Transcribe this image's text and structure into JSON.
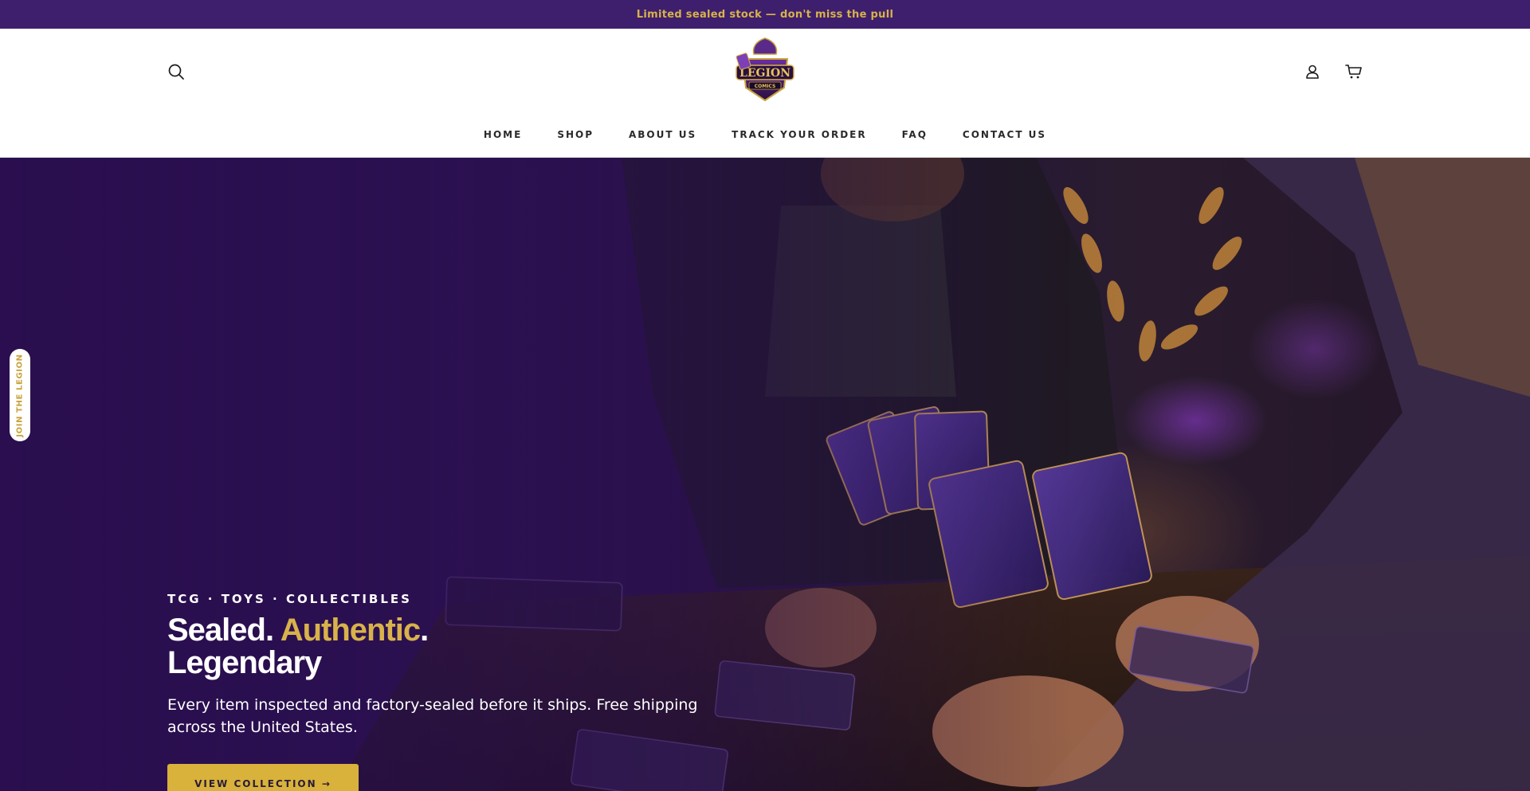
{
  "announcement": {
    "text": "Limited sealed stock — don't miss the pull"
  },
  "header": {
    "logo": {
      "brand_text": "LEGION",
      "sub_text": "COMICS"
    },
    "icons": {
      "search": "search-icon",
      "account": "account-icon",
      "cart": "cart-icon"
    },
    "nav": [
      {
        "label": "HOME"
      },
      {
        "label": "SHOP"
      },
      {
        "label": "ABOUT US"
      },
      {
        "label": "TRACK YOUR ORDER"
      },
      {
        "label": "FAQ"
      },
      {
        "label": "CONTACT US"
      }
    ]
  },
  "side_tab": {
    "label": "JOIN THE LEGION"
  },
  "hero": {
    "eyebrow": "TCG · TOYS · COLLECTIBLES",
    "headline_part1": "Sealed. ",
    "headline_accent": "Authentic",
    "headline_part2": ".",
    "headline_line2": "Legendary",
    "subtext": "Every item inspected and factory-sealed before it ships. Free shipping across the United States.",
    "cta_label": "VIEW COLLECTION →"
  },
  "colors": {
    "brand_purple": "#3e1f6e",
    "accent_gold": "#d8b24a",
    "header_bg": "#ffffff"
  }
}
